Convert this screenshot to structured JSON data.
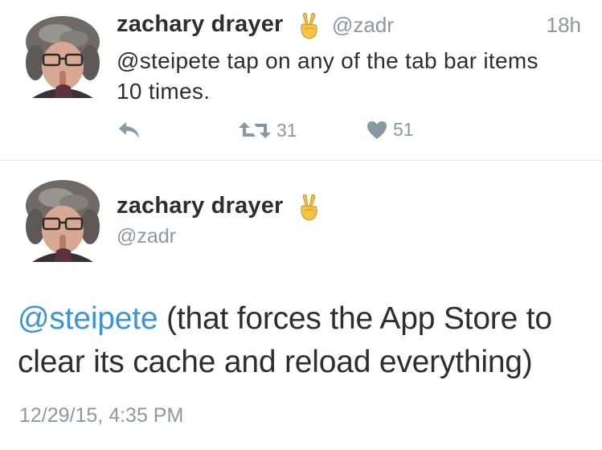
{
  "tweets": [
    {
      "author_name": "zachary drayer",
      "author_emoji": "victory-hand-emoji",
      "handle": "@zadr",
      "time": "18h",
      "text": "@steipete tap on any of the tab bar items 10 times.",
      "actions": {
        "reply_icon": "reply-icon",
        "retweet_icon": "retweet-icon",
        "retweet_count": "31",
        "like_icon": "heart-icon",
        "like_count": "51"
      }
    },
    {
      "author_name": "zachary drayer",
      "author_emoji": "victory-hand-emoji",
      "handle": "@zadr",
      "mention": "@steipete",
      "text": " (that forces the App Store to clear its cache and reload everything)",
      "date": "12/29/15, 4:35 PM"
    }
  ],
  "colors": {
    "text": "#292f33",
    "secondary": "#8899a6",
    "link": "#3b94d9",
    "divider": "#e1e8ed"
  }
}
